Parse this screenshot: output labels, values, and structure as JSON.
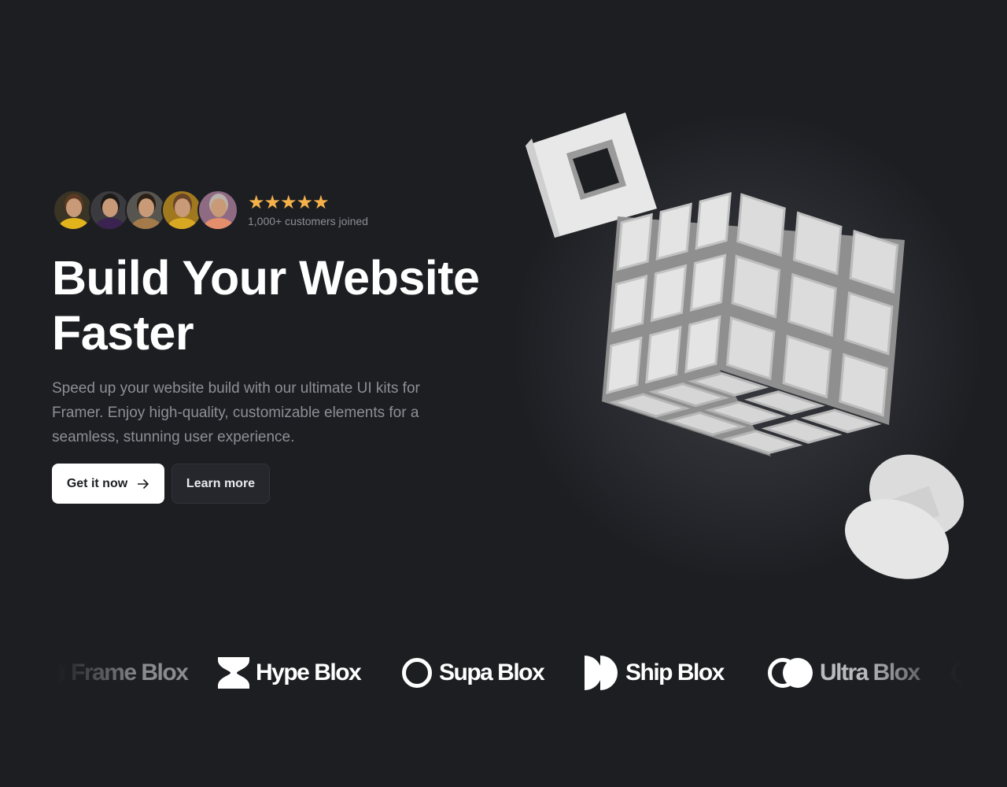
{
  "hero": {
    "rating_stars": 5,
    "stars_text": "★★★★★",
    "customers_text": "1,000+ customers joined",
    "title_line1": "Build Your Website",
    "title_line2": "Faster",
    "subtitle": "Speed up your website build with our ultimate UI kits for Framer. Enjoy high-quality, customizable elements for a seamless, stunning user experience.",
    "primary_button": "Get it now",
    "primary_icon": "arrow-right-icon",
    "secondary_button": "Learn more"
  },
  "avatars": [
    {
      "bg": "#3a3424",
      "shirt": "#e2b41c",
      "hair": "#5a3a22"
    },
    {
      "bg": "#3b3a3e",
      "shirt": "#3a2350",
      "hair": "#1d1a18"
    },
    {
      "bg": "#575550",
      "shirt": "#a47a4a",
      "hair": "#2a2016"
    },
    {
      "bg": "#a0781e",
      "shirt": "#d9a822",
      "hair": "#6a4428"
    },
    {
      "bg": "#8e6a83",
      "shirt": "#e48e6c",
      "hair": "#b8b2aa"
    }
  ],
  "logos": [
    {
      "name": "Frame Blox",
      "icon": "half-circle-icon"
    },
    {
      "name": "Hype Blox",
      "icon": "hourglass-icon"
    },
    {
      "name": "Supa Blox",
      "icon": "ring-icon"
    },
    {
      "name": "Ship Blox",
      "icon": "double-half-circle-icon"
    },
    {
      "name": "Ultra Blox",
      "icon": "overlapping-circles-icon"
    }
  ],
  "colors": {
    "background": "#1d1e22",
    "star": "#f4b14a",
    "primary_button": "#ffffff",
    "secondary_button": "#25272d",
    "muted_text": "#8d8f96"
  }
}
